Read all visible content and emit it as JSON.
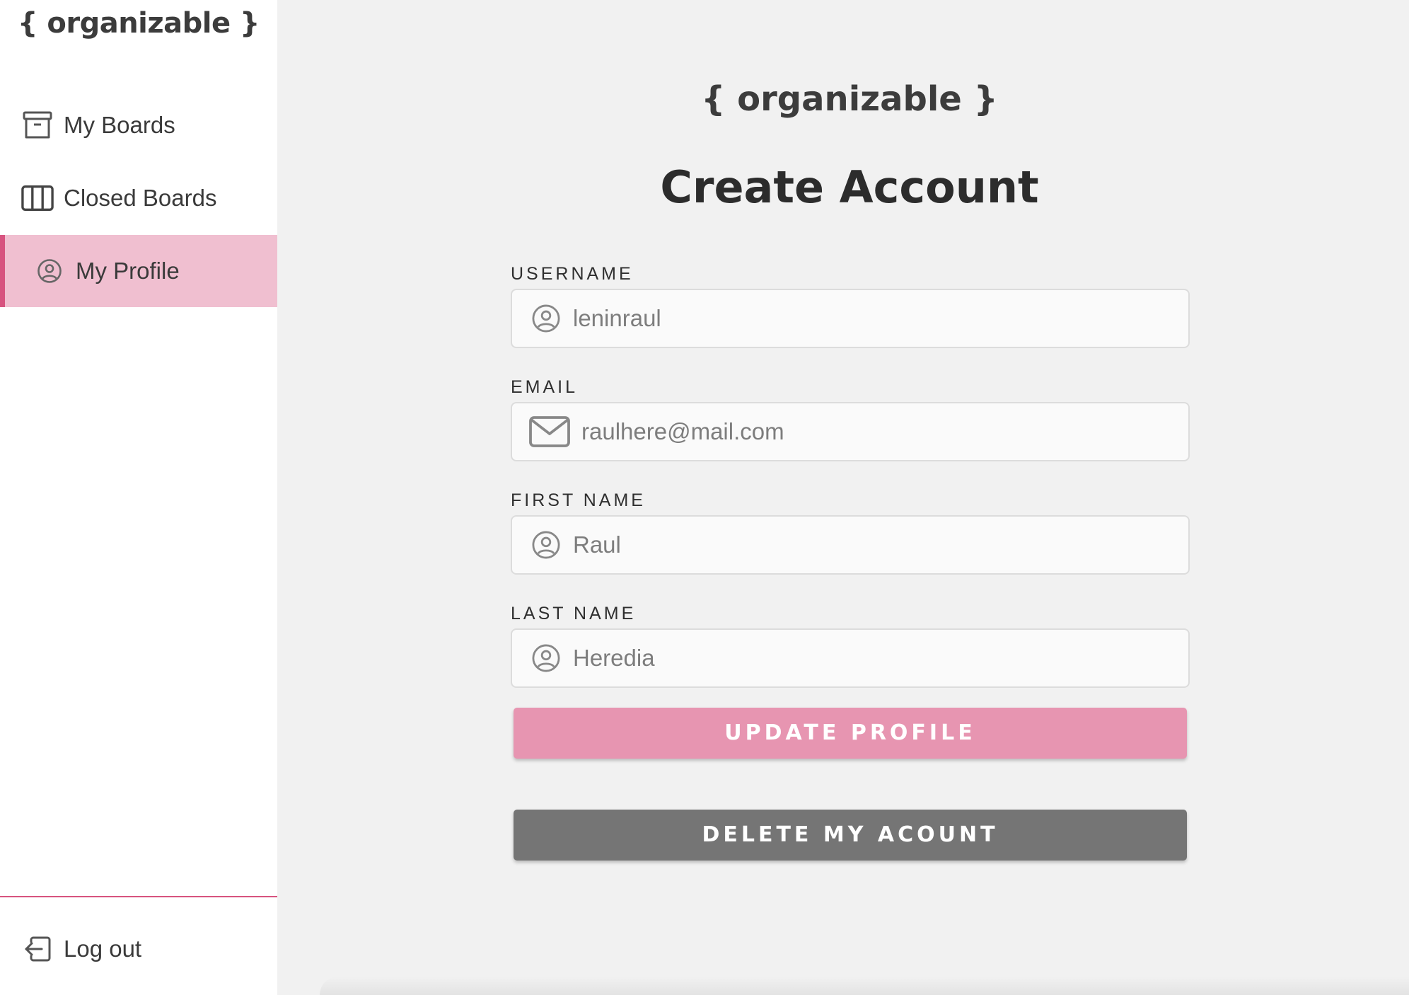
{
  "sidebar": {
    "brand": "{ organizable }",
    "items": [
      {
        "label": "My Boards",
        "icon": "archive-box-icon"
      },
      {
        "label": "Closed Boards",
        "icon": "columns-icon"
      },
      {
        "label": "My Profile",
        "icon": "user-circle-icon",
        "active": true
      }
    ],
    "logout": {
      "label": "Log out",
      "icon": "logout-icon"
    }
  },
  "main": {
    "brand": "{ organizable }",
    "title": "Create Account",
    "fields": [
      {
        "label": "USERNAME",
        "value": "leninraul",
        "icon": "user-circle-icon"
      },
      {
        "label": "EMAIL",
        "value": "raulhere@mail.com",
        "icon": "envelope-icon"
      },
      {
        "label": "FIRST NAME",
        "value": "Raul",
        "icon": "user-circle-icon"
      },
      {
        "label": "LAST NAME",
        "value": "Heredia",
        "icon": "user-circle-icon"
      }
    ],
    "update_button": "UPDATE PROFILE",
    "delete_button": "DELETE MY ACOUNT"
  },
  "colors": {
    "accent": "#d7537f",
    "active_bg": "#f0bfd0",
    "update_button": "#e795b1",
    "delete_button": "#757575",
    "page_bg": "#f1f1f1"
  }
}
